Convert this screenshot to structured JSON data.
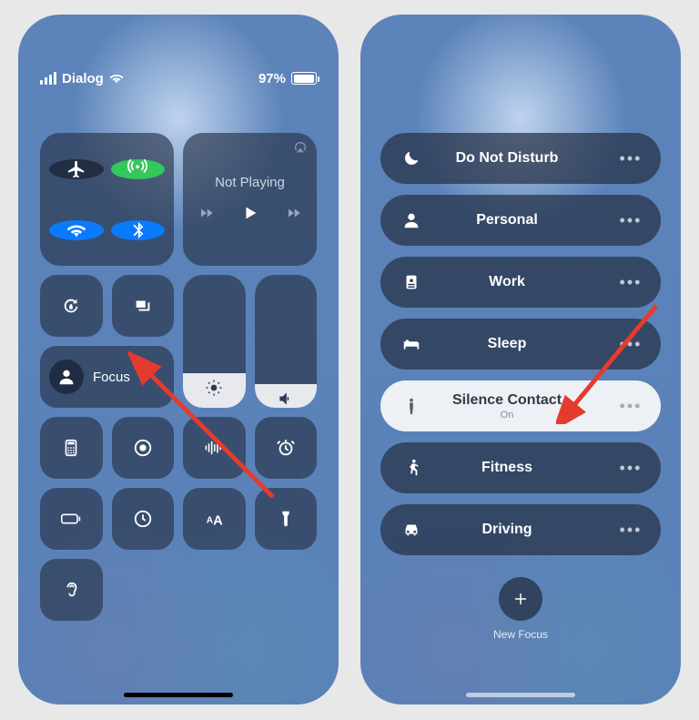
{
  "status": {
    "carrier": "Dialog",
    "battery_pct": "97%",
    "battery_fill_pct": 97
  },
  "media": {
    "title": "Not Playing"
  },
  "focus_button": {
    "label": "Focus"
  },
  "focus_list": {
    "items": [
      {
        "label": "Do Not Disturb",
        "icon": "moon-icon",
        "active": false
      },
      {
        "label": "Personal",
        "icon": "person-icon",
        "active": false
      },
      {
        "label": "Work",
        "icon": "badge-icon",
        "active": false
      },
      {
        "label": "Sleep",
        "icon": "bed-icon",
        "active": false
      },
      {
        "label": "Silence Contact",
        "sub": "On",
        "icon": "standing-person-icon",
        "active": true
      },
      {
        "label": "Fitness",
        "icon": "running-icon",
        "active": false
      },
      {
        "label": "Driving",
        "icon": "car-icon",
        "active": false
      }
    ],
    "new_label": "New Focus"
  }
}
